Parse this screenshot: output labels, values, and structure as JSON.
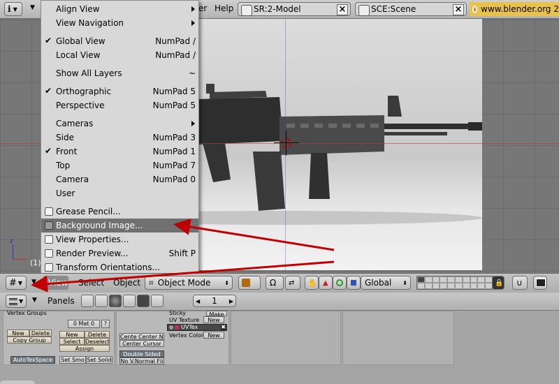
{
  "top_bar": {
    "help_label": "Help",
    "menu_partial": "er",
    "screen_field": "SR:2-Model",
    "scene_field": "SCE:Scene",
    "website": "www.blender.org 2"
  },
  "viewport": {
    "frame_number": "(1)"
  },
  "view_menu": {
    "items": [
      {
        "label": "Align View",
        "shortcut": "",
        "submenu": true
      },
      {
        "label": "View Navigation",
        "shortcut": "",
        "submenu": true
      },
      {
        "label": "Global View",
        "shortcut": "NumPad /",
        "checked": true
      },
      {
        "label": "Local View",
        "shortcut": "NumPad /"
      },
      {
        "label": "Show All Layers",
        "shortcut": "~"
      },
      {
        "label": "Orthographic",
        "shortcut": "NumPad 5",
        "checked": true
      },
      {
        "label": "Perspective",
        "shortcut": "NumPad 5"
      },
      {
        "label": "Cameras",
        "shortcut": "",
        "submenu": true
      },
      {
        "label": "Side",
        "shortcut": "NumPad 3"
      },
      {
        "label": "Front",
        "shortcut": "NumPad 1",
        "checked": true
      },
      {
        "label": "Top",
        "shortcut": "NumPad 7"
      },
      {
        "label": "Camera",
        "shortcut": "NumPad 0"
      },
      {
        "label": "User",
        "shortcut": ""
      },
      {
        "label": "Grease Pencil...",
        "shortcut": ""
      },
      {
        "label": "Background Image...",
        "shortcut": ""
      },
      {
        "label": "View Properties...",
        "shortcut": ""
      },
      {
        "label": "Render Preview...",
        "shortcut": "Shift P"
      },
      {
        "label": "Transform Orientations...",
        "shortcut": ""
      }
    ]
  },
  "view_header": {
    "view_label": "View",
    "select_label": "Select",
    "object_label": "Object",
    "mode": "Object Mode",
    "orientation": "Global"
  },
  "buttons_window": {
    "panels_label": "Panels",
    "frame_value": "1",
    "vertex_groups_label": "Vertex Groups",
    "mat_field": "0 Mat 0",
    "mat_q": "?",
    "new1": "New",
    "delete1": "Delete",
    "copy_group": "Copy Group",
    "new2": "New",
    "delete2": "Delete",
    "select": "Select",
    "deselect": "Deselect",
    "assign": "Assign",
    "autotexspace": "AutoTexSpace",
    "set_smo": "Set Smo",
    "set_solid": "Set Solid",
    "sticky": "Sticky",
    "make": "Make",
    "uv_texture": "UV Texture",
    "new3": "New",
    "uvtex": "UVTex",
    "vertex_color": "Vertex Color",
    "new4": "New",
    "center_new": "Cente Center Ne",
    "center_cursor": "Center Cursor",
    "double_sided": "Double Sided",
    "no_v_normal": "No V.Normal Fli"
  },
  "colors": {
    "menu_highlight": "#707070",
    "annotation_arrow": "#c00000",
    "3d_cursor": "#c00000"
  }
}
